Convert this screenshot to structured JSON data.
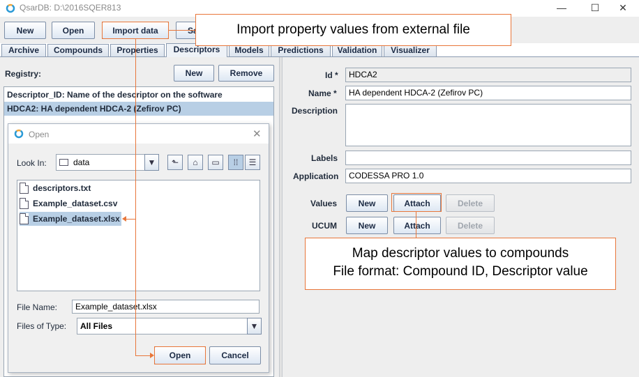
{
  "window": {
    "title": "QsarDB: D:\\2016SQER813",
    "controls": {
      "minimize": "—",
      "maximize": "☐",
      "close": "✕"
    }
  },
  "toolbar": {
    "new_label": "New",
    "open_label": "Open",
    "import_label": "Import data",
    "save_partial": "Sa"
  },
  "tabs": [
    "Archive",
    "Compounds",
    "Properties",
    "Descriptors",
    "Models",
    "Predictions",
    "Validation",
    "Visualizer"
  ],
  "registry": {
    "label": "Registry:",
    "new_label": "New",
    "remove_label": "Remove",
    "items": [
      "Descriptor_ID: Name of the descriptor on the software",
      "HDCA2: HA dependent HDCA-2 (Zefirov PC)"
    ]
  },
  "form": {
    "id_label": "Id *",
    "id_value": "HDCA2",
    "name_label": "Name *",
    "name_value": "HA dependent HDCA-2 (Zefirov PC)",
    "description_label": "Description",
    "description_value": "",
    "labels_label": "Labels",
    "labels_value": "",
    "application_label": "Application",
    "application_value": "CODESSA PRO 1.0",
    "values_label": "Values",
    "ucum_label": "UCUM",
    "new_label": "New",
    "attach_label": "Attach",
    "delete_label": "Delete"
  },
  "callouts": {
    "import": "Import property values from external file",
    "map_line1": "Map descriptor values to compounds",
    "map_line2": "File format: Compound ID, Descriptor value"
  },
  "open_dialog": {
    "title": "Open",
    "lookin_label": "Look In:",
    "lookin_value": "data",
    "files": [
      "descriptors.txt",
      "Example_dataset.csv",
      "Example_dataset.xlsx"
    ],
    "filename_label": "File Name:",
    "filename_value": "Example_dataset.xlsx",
    "filetype_label": "Files of Type:",
    "filetype_value": "All Files",
    "open_label": "Open",
    "cancel_label": "Cancel"
  },
  "colors": {
    "accent": "#e8763a",
    "selection": "#b8cfe5"
  }
}
